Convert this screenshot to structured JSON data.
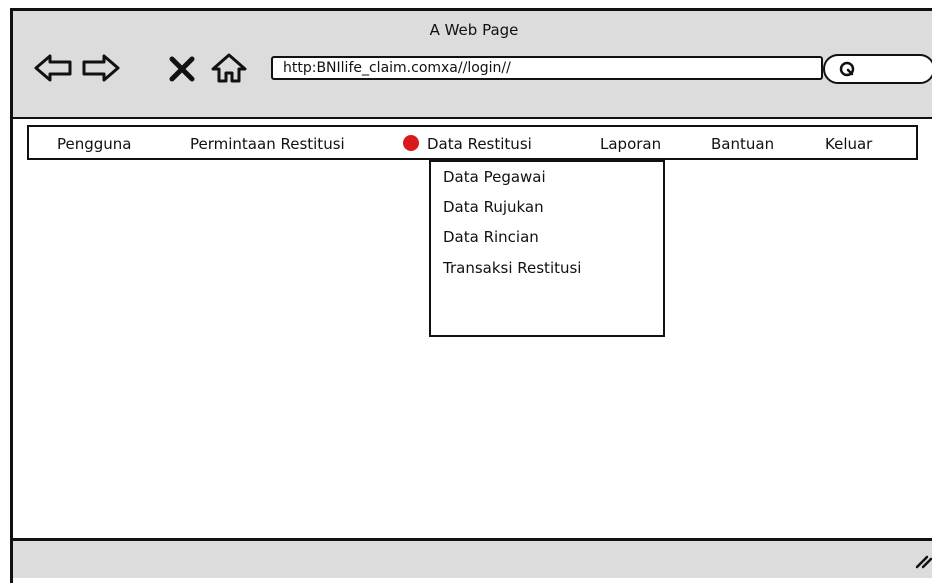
{
  "window": {
    "title": "A Web Page"
  },
  "toolbar": {
    "back_icon": "back-arrow-icon",
    "forward_icon": "forward-arrow-icon",
    "close_icon": "close-icon",
    "home_icon": "home-icon",
    "url": "http:BNIlife_claim.comxa//login//",
    "search_icon": "search-icon"
  },
  "menu": {
    "items": [
      {
        "label": "Pengguna"
      },
      {
        "label": "Permintaan Restitusi"
      },
      {
        "label": "Data Restitusi"
      },
      {
        "label": "Laporan"
      },
      {
        "label": "Bantuan"
      },
      {
        "label": "Keluar"
      }
    ]
  },
  "dropdown": {
    "items": [
      {
        "label": "Data Pegawai"
      },
      {
        "label": "Data Rujukan"
      },
      {
        "label": "Data Rincian"
      },
      {
        "label": "Transaksi Restitusi"
      }
    ]
  },
  "colors": {
    "chrome": "#dcdcdc",
    "border": "#111111",
    "cursor_marker": "#d91a1a"
  }
}
